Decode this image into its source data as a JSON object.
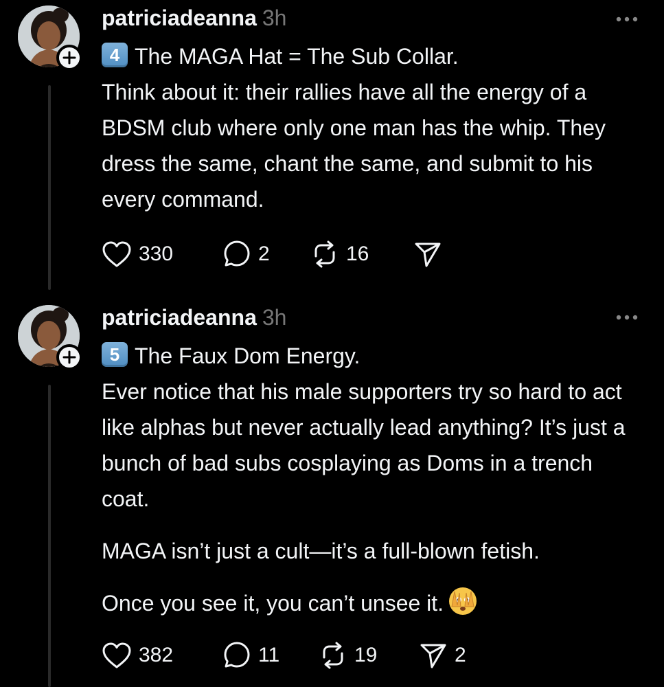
{
  "posts": [
    {
      "username": "patriciadeanna",
      "timestamp": "3h",
      "keycap": "4",
      "headline": "The MAGA Hat = The Sub Collar.",
      "paragraphs": [
        "Think about it: their rallies have all the energy of a BDSM club where only one man has the whip. They dress the same, chant the same, and submit to his every command."
      ],
      "likes": "330",
      "replies": "2",
      "reposts": "16",
      "shares": ""
    },
    {
      "username": "patriciadeanna",
      "timestamp": "3h",
      "keycap": "5",
      "headline": "The Faux Dom Energy.",
      "paragraphs": [
        "Ever notice that his male supporters try so hard to act like alphas but never actually lead anything? It’s just a bunch of bad subs cosplaying as Doms in a trench coat.",
        "MAGA isn’t just a cult—it’s a full-blown fetish.",
        "Once you see it, you can’t unsee it."
      ],
      "likes": "382",
      "replies": "11",
      "reposts": "19",
      "shares": "2"
    }
  ],
  "icons": {
    "like": "heart-icon",
    "reply": "comment-bubble-icon",
    "repost": "repost-arrows-icon",
    "share": "send-paper-plane-icon",
    "more": "more-dots-icon",
    "follow": "plus-icon",
    "emoji": "face-peeking-through-hands-emoji"
  },
  "colors": {
    "background": "#000000",
    "text": "#f3f5f7",
    "muted": "#777777",
    "keycap": "#5f9bcf"
  }
}
